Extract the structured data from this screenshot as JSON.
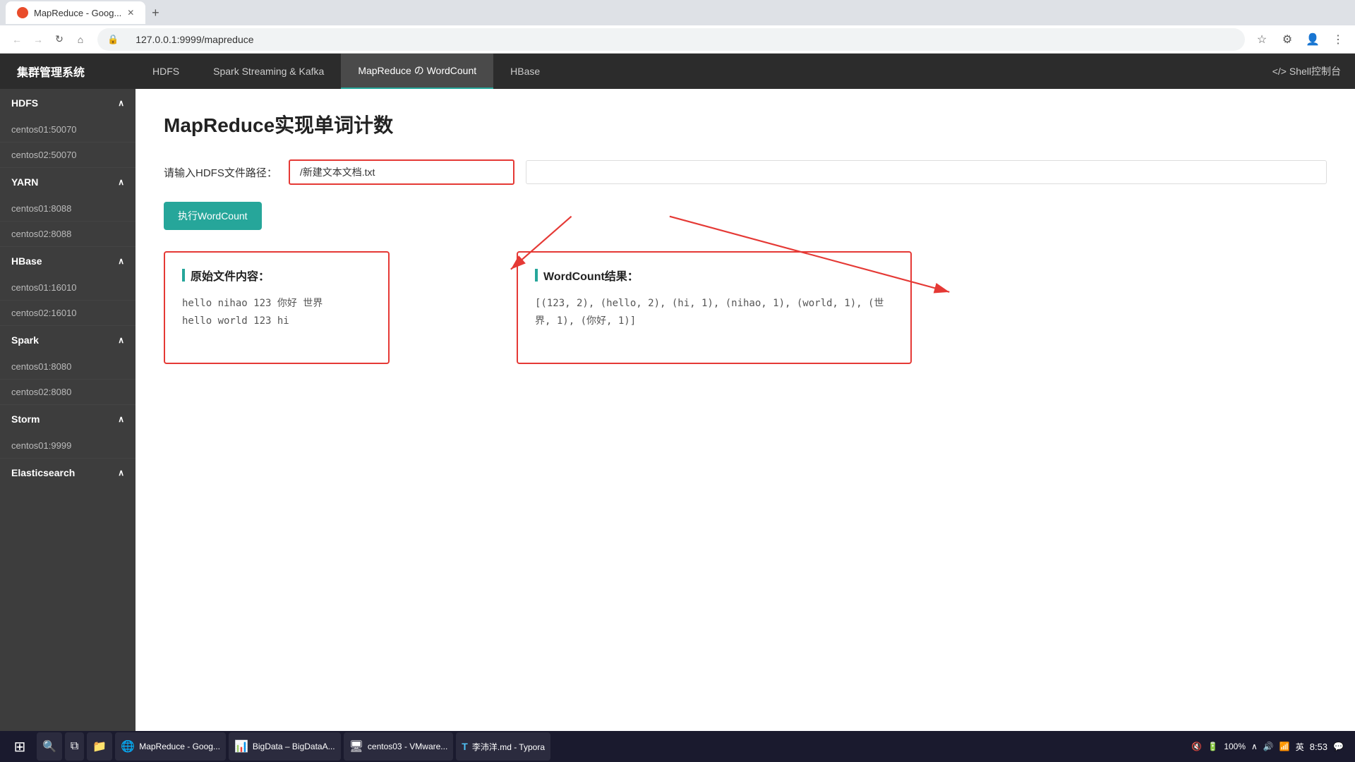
{
  "browser": {
    "tab_title": "MapReduce - Goog...",
    "url": "127.0.0.1:9999/mapreduce",
    "tab_icon": "●"
  },
  "topnav": {
    "brand": "集群管理系统",
    "tabs": [
      {
        "label": "HDFS",
        "active": false
      },
      {
        "label": "Spark Streaming & Kafka",
        "active": false
      },
      {
        "label": "MapReduce の WordCount",
        "active": true
      },
      {
        "label": "HBase",
        "active": false
      }
    ],
    "shell_label": "</> Shell控制台"
  },
  "sidebar": {
    "sections": [
      {
        "name": "HDFS",
        "items": [
          "centos01:50070",
          "centos02:50070"
        ]
      },
      {
        "name": "YARN",
        "items": [
          "centos01:8088",
          "centos02:8088"
        ]
      },
      {
        "name": "HBase",
        "items": [
          "centos01:16010",
          "centos02:16010"
        ]
      },
      {
        "name": "Spark",
        "items": [
          "centos01:8080",
          "centos02:8080"
        ]
      },
      {
        "name": "Storm",
        "items": [
          "centos01:9999"
        ]
      },
      {
        "name": "Elasticsearch",
        "items": []
      }
    ]
  },
  "content": {
    "page_title": "MapReduce实现单词计数",
    "input_label": "请输入HDFS文件路径：",
    "input_value": "/新建文本文档.txt",
    "run_button": "执行WordCount",
    "original_box": {
      "title": "原始文件内容：",
      "content": "hello nihao 123 你好 世界\nhello world 123 hi"
    },
    "result_box": {
      "title": "WordCount结果：",
      "content": "[(123, 2), (hello, 2), (hi, 1), (nihao, 1), (world, 1), (世界, 1), (你好, 1)]"
    }
  },
  "taskbar": {
    "start_icon": "⊞",
    "apps": [
      {
        "label": "MapReduce - Goog...",
        "icon": "🌐"
      },
      {
        "label": "BigData – BigDataA...",
        "icon": "📊"
      },
      {
        "label": "centos03 - VMware...",
        "icon": "🖥"
      },
      {
        "label": "李沛洋.md - Typora",
        "icon": "📝"
      }
    ],
    "time": "8:53",
    "battery": "100%",
    "lang": "英"
  }
}
